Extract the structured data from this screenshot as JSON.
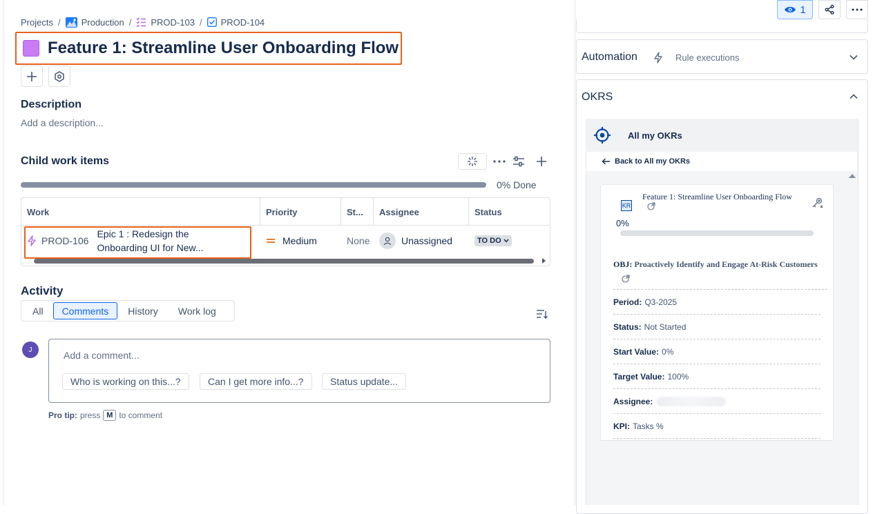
{
  "breadcrumb": {
    "projects": "Projects",
    "production": "Production",
    "parent": "PROD-103",
    "current": "PROD-104"
  },
  "title": "Feature 1: Streamline User Onboarding Flow",
  "description": {
    "heading": "Description",
    "placeholder": "Add a description..."
  },
  "child_items": {
    "heading": "Child work items",
    "progress_label": "0% Done",
    "progress_percent": 0,
    "columns": [
      "Work",
      "Priority",
      "St...",
      "Assignee",
      "Status"
    ],
    "row": {
      "key": "PROD-106",
      "summary_line1": "Epic 1 : Redesign the",
      "summary_line2": "Onboarding UI for New...",
      "priority": "Medium",
      "story": "None",
      "assignee": "Unassigned",
      "status": "TO DO"
    }
  },
  "activity": {
    "heading": "Activity",
    "tabs": [
      "All",
      "Comments",
      "History",
      "Work log"
    ],
    "active_tab": "Comments",
    "avatar_initial": "J",
    "comment_placeholder": "Add a comment...",
    "suggestions": [
      "Who is working on this...?",
      "Can I get more info...?",
      "Status update..."
    ],
    "protip_label": "Pro tip:",
    "protip_press": "press",
    "protip_key": "M",
    "protip_suffix": "to comment"
  },
  "top_actions": {
    "watchers_count": "1"
  },
  "automation": {
    "title": "Automation",
    "link": "Rule executions"
  },
  "okrs": {
    "title": "OKRS",
    "app_title": "All my OKRs",
    "back_link": "Back to All my OKRs",
    "kr_badge": "KR",
    "kr_title": "Feature 1: Streamline User Onboarding Flow",
    "kr_percent": "0%",
    "kr_progress": 0,
    "objective_label": "OBJ:",
    "objective_text": "Proactively Identify and Engage At-Risk Customers",
    "fields": [
      {
        "label": "Period:",
        "value": "Q3-2025"
      },
      {
        "label": "Status:",
        "value": "Not Started"
      },
      {
        "label": "Start Value:",
        "value": "0%"
      },
      {
        "label": "Target Value:",
        "value": "100%"
      },
      {
        "label": "Assignee:",
        "value": ""
      },
      {
        "label": "KPI:",
        "value": "Tasks %"
      }
    ]
  }
}
